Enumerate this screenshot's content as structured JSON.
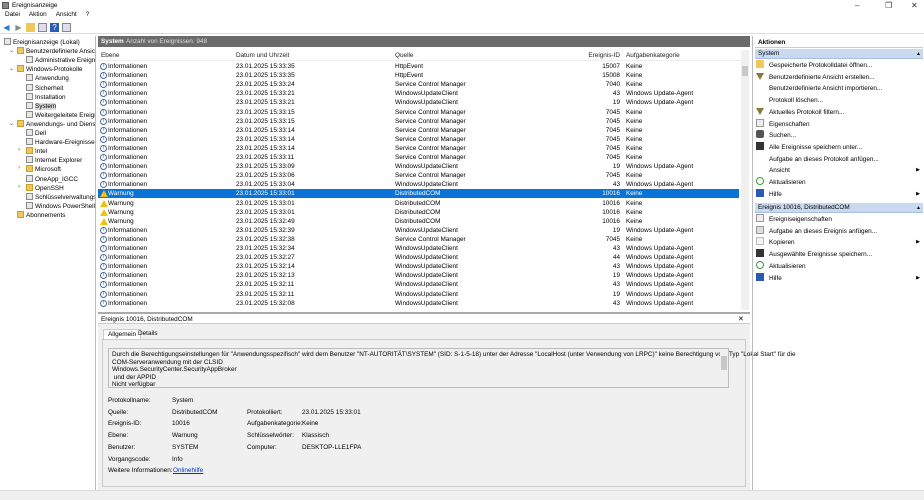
{
  "window": {
    "title": "Ereignisanzeige",
    "minimize": "–",
    "maximize": "❐",
    "close": "✕"
  },
  "menu": [
    "Datei",
    "Aktion",
    "Ansicht",
    "?"
  ],
  "tree": [
    {
      "label": "Ereignisanzeige (Lokal)",
      "level": 0
    },
    {
      "label": "Benutzerdefinierte Ansichten",
      "level": 1,
      "exp": "v"
    },
    {
      "label": "Administrative Ereignisse",
      "level": 2
    },
    {
      "label": "Windows-Protokolle",
      "level": 1,
      "exp": "v"
    },
    {
      "label": "Anwendung",
      "level": 2
    },
    {
      "label": "Sicherheit",
      "level": 2
    },
    {
      "label": "Installation",
      "level": 2
    },
    {
      "label": "System",
      "level": 2,
      "selected": true
    },
    {
      "label": "Weitergeleitete Ereignisse",
      "level": 2
    },
    {
      "label": "Anwendungs- und Dienstprotokolle",
      "level": 1,
      "exp": "v"
    },
    {
      "label": "Dell",
      "level": 2
    },
    {
      "label": "Hardware-Ereignisse",
      "level": 2
    },
    {
      "label": "Intel",
      "level": 2,
      "exp": ">",
      "folder": true
    },
    {
      "label": "Internet Explorer",
      "level": 2
    },
    {
      "label": "Microsoft",
      "level": 2,
      "exp": ">",
      "folder": true
    },
    {
      "label": "OneApp_IGCC",
      "level": 2
    },
    {
      "label": "OpenSSH",
      "level": 2,
      "exp": ">",
      "folder": true
    },
    {
      "label": "Schlüsselverwaltungsdienst",
      "level": 2
    },
    {
      "label": "Windows PowerShell",
      "level": 2
    },
    {
      "label": "Abonnements",
      "level": 1
    }
  ],
  "list": {
    "title": "System",
    "count": "Anzahl von Ereignissen: 948",
    "columns": [
      "Ebene",
      "Datum und Uhrzeit",
      "Quelle",
      "Ereignis-ID",
      "Aufgabenkategorie"
    ],
    "rows": [
      [
        "Informationen",
        "23.01.2025 15:33:35",
        "HttpEvent",
        "15007",
        "Keine"
      ],
      [
        "Informationen",
        "23.01.2025 15:33:35",
        "HttpEvent",
        "15008",
        "Keine"
      ],
      [
        "Informationen",
        "23.01.2025 15:33:24",
        "Service Control Manager",
        "7040",
        "Keine"
      ],
      [
        "Informationen",
        "23.01.2025 15:33:21",
        "WindowsUpdateClient",
        "43",
        "Windows Update-Agent"
      ],
      [
        "Informationen",
        "23.01.2025 15:33:21",
        "WindowsUpdateClient",
        "19",
        "Windows Update-Agent"
      ],
      [
        "Informationen",
        "23.01.2025 15:33:15",
        "Service Control Manager",
        "7045",
        "Keine"
      ],
      [
        "Informationen",
        "23.01.2025 15:33:15",
        "Service Control Manager",
        "7045",
        "Keine"
      ],
      [
        "Informationen",
        "23.01.2025 15:33:14",
        "Service Control Manager",
        "7045",
        "Keine"
      ],
      [
        "Informationen",
        "23.01.2025 15:33:14",
        "Service Control Manager",
        "7045",
        "Keine"
      ],
      [
        "Informationen",
        "23.01.2025 15:33:14",
        "Service Control Manager",
        "7045",
        "Keine"
      ],
      [
        "Informationen",
        "23.01.2025 15:33:11",
        "Service Control Manager",
        "7045",
        "Keine"
      ],
      [
        "Informationen",
        "23.01.2025 15:33:09",
        "WindowsUpdateClient",
        "19",
        "Windows Update-Agent"
      ],
      [
        "Informationen",
        "23.01.2025 15:33:06",
        "Service Control Manager",
        "7045",
        "Keine"
      ],
      [
        "Informationen",
        "23.01.2025 15:33:04",
        "WindowsUpdateClient",
        "43",
        "Windows Update-Agent"
      ],
      [
        "Warnung",
        "23.01.2025 15:33:01",
        "DistributedCOM",
        "10016",
        "Keine"
      ],
      [
        "Warnung",
        "23.01.2025 15:33:01",
        "DistributedCOM",
        "10016",
        "Keine"
      ],
      [
        "Warnung",
        "23.01.2025 15:33:01",
        "DistributedCOM",
        "10016",
        "Keine"
      ],
      [
        "Warnung",
        "23.01.2025 15:32:49",
        "DistributedCOM",
        "10016",
        "Keine"
      ],
      [
        "Informationen",
        "23.01.2025 15:32:39",
        "WindowsUpdateClient",
        "19",
        "Windows Update-Agent"
      ],
      [
        "Informationen",
        "23.01.2025 15:32:38",
        "Service Control Manager",
        "7045",
        "Keine"
      ],
      [
        "Informationen",
        "23.01.2025 15:32:34",
        "WindowsUpdateClient",
        "43",
        "Windows Update-Agent"
      ],
      [
        "Informationen",
        "23.01.2025 15:32:27",
        "WindowsUpdateClient",
        "44",
        "Windows Update-Agent"
      ],
      [
        "Informationen",
        "23.01.2025 15:32:14",
        "WindowsUpdateClient",
        "43",
        "Windows Update-Agent"
      ],
      [
        "Informationen",
        "23.01.2025 15:32:13",
        "WindowsUpdateClient",
        "19",
        "Windows Update-Agent"
      ],
      [
        "Informationen",
        "23.01.2025 15:32:11",
        "WindowsUpdateClient",
        "43",
        "Windows Update-Agent"
      ],
      [
        "Informationen",
        "23.01.2025 15:32:11",
        "WindowsUpdateClient",
        "19",
        "Windows Update-Agent"
      ],
      [
        "Informationen",
        "23.01.2025 15:32:08",
        "WindowsUpdateClient",
        "43",
        "Windows Update-Agent"
      ]
    ],
    "selected_index": 14
  },
  "detail": {
    "title": "Ereignis 10016, DistributedCOM",
    "close": "✕",
    "tabs": [
      "Allgemein",
      "Details"
    ],
    "message": "Durch die Berechtigungseinstellungen für \"Anwendungsspezifisch\" wird dem Benutzer \"NT-AUTORITÄT\\SYSTEM\" (SID: S-1-5-18) unter der Adresse \"LocalHost (unter Verwendung von LRPC)\" keine Berechtigung vom Typ \"Lokal Start\" für die\nCOM-Serveranwendung mit der CLSID\nWindows.SecurityCenter.SecurityAppBroker\n und der APPID\nNicht verfügbar",
    "fields": {
      "protokollname": {
        "label": "Protokollname:",
        "value": "System"
      },
      "quelle": {
        "label": "Quelle:",
        "value": "DistributedCOM"
      },
      "protokolliert": {
        "label": "Protokolliert:",
        "value": "23.01.2025 15:33:01"
      },
      "ereignis_id": {
        "label": "Ereignis-ID:",
        "value": "10016"
      },
      "aufgabenkategorie": {
        "label": "Aufgabenkategorie:",
        "value": "Keine"
      },
      "ebene": {
        "label": "Ebene:",
        "value": "Warnung"
      },
      "schluesselwoerter": {
        "label": "Schlüsselwörter:",
        "value": "Klassisch"
      },
      "benutzer": {
        "label": "Benutzer:",
        "value": "SYSTEM"
      },
      "computer": {
        "label": "Computer:",
        "value": "DESKTOP-LLE1FPA"
      },
      "vorgangscode": {
        "label": "Vorgangscode:",
        "value": "Info"
      },
      "weitere": {
        "label": "Weitere Informationen:",
        "value": "Onlinehilfe"
      }
    }
  },
  "actions": {
    "title": "Aktionen",
    "section1": {
      "title": "System",
      "items": [
        {
          "label": "Gespeicherte Protokolldatei öffnen...",
          "icon": "folder-open-icon"
        },
        {
          "label": "Benutzerdefinierte Ansicht erstellen...",
          "icon": "filter-icon"
        },
        {
          "label": "Benutzerdefinierte Ansicht importieren...",
          "icon": ""
        },
        {
          "label": "Protokoll löschen...",
          "icon": ""
        },
        {
          "label": "Aktuelles Protokoll filtern...",
          "icon": "filter-icon"
        },
        {
          "label": "Eigenschaften",
          "icon": "properties-icon"
        },
        {
          "label": "Suchen...",
          "icon": "binoculars-icon"
        },
        {
          "label": "Alle Ereignisse speichern unter...",
          "icon": "save-icon"
        },
        {
          "label": "Aufgabe an dieses Protokoll anfügen...",
          "icon": ""
        },
        {
          "label": "Ansicht",
          "icon": "",
          "submenu": true
        },
        {
          "label": "Aktualisieren",
          "icon": "refresh-icon"
        },
        {
          "label": "Hilfe",
          "icon": "help-icon",
          "submenu": true
        }
      ]
    },
    "section2": {
      "title": "Ereignis 10016, DistributedCOM",
      "items": [
        {
          "label": "Ereigniseigenschaften",
          "icon": "properties-icon"
        },
        {
          "label": "Aufgabe an dieses Ereignis anfügen...",
          "icon": "task-icon"
        },
        {
          "label": "Kopieren",
          "icon": "copy-icon",
          "submenu": true
        },
        {
          "label": "Ausgewählte Ereignisse speichern...",
          "icon": "save-icon"
        },
        {
          "label": "Aktualisieren",
          "icon": "refresh-icon"
        },
        {
          "label": "Hilfe",
          "icon": "help-icon",
          "submenu": true
        }
      ]
    }
  },
  "colors": {
    "selection": "#0a74d6",
    "header_bar": "#6b6b6b",
    "section": "#c9daf0",
    "link": "#0033cc",
    "warning": "#f2c010",
    "info": "#4a6a98"
  }
}
